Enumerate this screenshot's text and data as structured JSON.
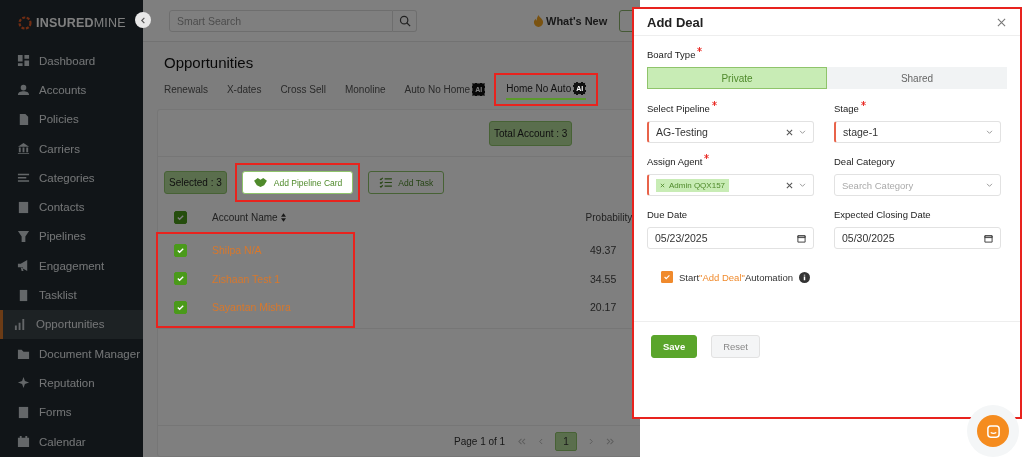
{
  "sidebar": {
    "logo": {
      "bold": "INSURED",
      "light": "MINE"
    },
    "items": [
      {
        "label": "Dashboard",
        "selected": false
      },
      {
        "label": "Accounts",
        "selected": false
      },
      {
        "label": "Policies",
        "selected": false
      },
      {
        "label": "Carriers",
        "selected": false
      },
      {
        "label": "Categories",
        "selected": false
      },
      {
        "label": "Contacts",
        "selected": false
      },
      {
        "label": "Pipelines",
        "selected": false
      },
      {
        "label": "Engagement",
        "selected": false
      },
      {
        "label": "Tasklist",
        "selected": false
      },
      {
        "label": "Opportunities",
        "selected": true
      },
      {
        "label": "Document Manager",
        "selected": false
      },
      {
        "label": "Reputation",
        "selected": false
      },
      {
        "label": "Forms",
        "selected": false
      },
      {
        "label": "Calendar",
        "selected": false
      }
    ]
  },
  "topbar": {
    "search": {
      "placeholder": "Smart Search"
    },
    "whats_new": "What's New"
  },
  "page": {
    "title": "Opportunities",
    "tabs": [
      {
        "label": "Renewals",
        "selected": false,
        "highlighted": false
      },
      {
        "label": "X-dates",
        "selected": false,
        "highlighted": false
      },
      {
        "label": "Cross Sell",
        "selected": false,
        "highlighted": false
      },
      {
        "label": "Monoline",
        "selected": false,
        "highlighted": false
      },
      {
        "label": "Auto No Home",
        "badge": "AI",
        "selected": false,
        "highlighted": false
      },
      {
        "label": "Home No Auto",
        "badge": "AI",
        "selected": true,
        "highlighted": true
      }
    ],
    "total_account": "Total Account : 3",
    "selected_count": "Selected : 3",
    "actions": [
      {
        "label": "Add Pipeline Card",
        "kind": "pipeline",
        "highlighted": true
      },
      {
        "label": "Add Task",
        "kind": "task",
        "highlighted": false
      }
    ],
    "table": {
      "header_checked": true,
      "columns": [
        "Account Name",
        "Probability"
      ],
      "rows": [
        {
          "name": "Shilpa N/A",
          "checked": true,
          "probability": "49.37"
        },
        {
          "name": "Zishaan Test 1",
          "checked": true,
          "probability": "34.55"
        },
        {
          "name": "Sayantan Mishra",
          "checked": true,
          "probability": "20.17"
        }
      ]
    },
    "pagination": {
      "summary": "Page 1 of 1",
      "pages": [
        {
          "label": "1",
          "selected": true
        }
      ]
    }
  },
  "drawer": {
    "title": "Add Deal",
    "board_type": {
      "label": "Board Type",
      "required": true,
      "options": [
        {
          "label": "Private",
          "selected": true
        },
        {
          "label": "Shared",
          "selected": false
        }
      ]
    },
    "fields": [
      {
        "kind": "select",
        "label": "Select Pipeline",
        "required": true,
        "value": "AG-Testing",
        "clearable": true
      },
      {
        "kind": "select",
        "label": "Stage",
        "required": true,
        "value": "stage-1",
        "clearable": false
      },
      {
        "kind": "tags",
        "label": "Assign Agent",
        "required": true,
        "tags": [
          "Admin QQX157"
        ],
        "clearable": true
      },
      {
        "kind": "select",
        "label": "Deal Category",
        "required": false,
        "placeholder": "Search Category",
        "clearable": false
      },
      {
        "kind": "date",
        "label": "Due Date",
        "required": false,
        "value": "05/23/2025"
      },
      {
        "kind": "date",
        "label": "Expected Closing Date",
        "required": false,
        "value": "05/30/2025"
      }
    ],
    "automation": {
      "checked": true,
      "prefix": "Start",
      "highlight": "\"Add Deal\"",
      "suffix": "Automation"
    },
    "buttons": [
      {
        "label": "Save",
        "kind": "primary"
      },
      {
        "label": "Reset",
        "kind": "secondary"
      }
    ]
  }
}
